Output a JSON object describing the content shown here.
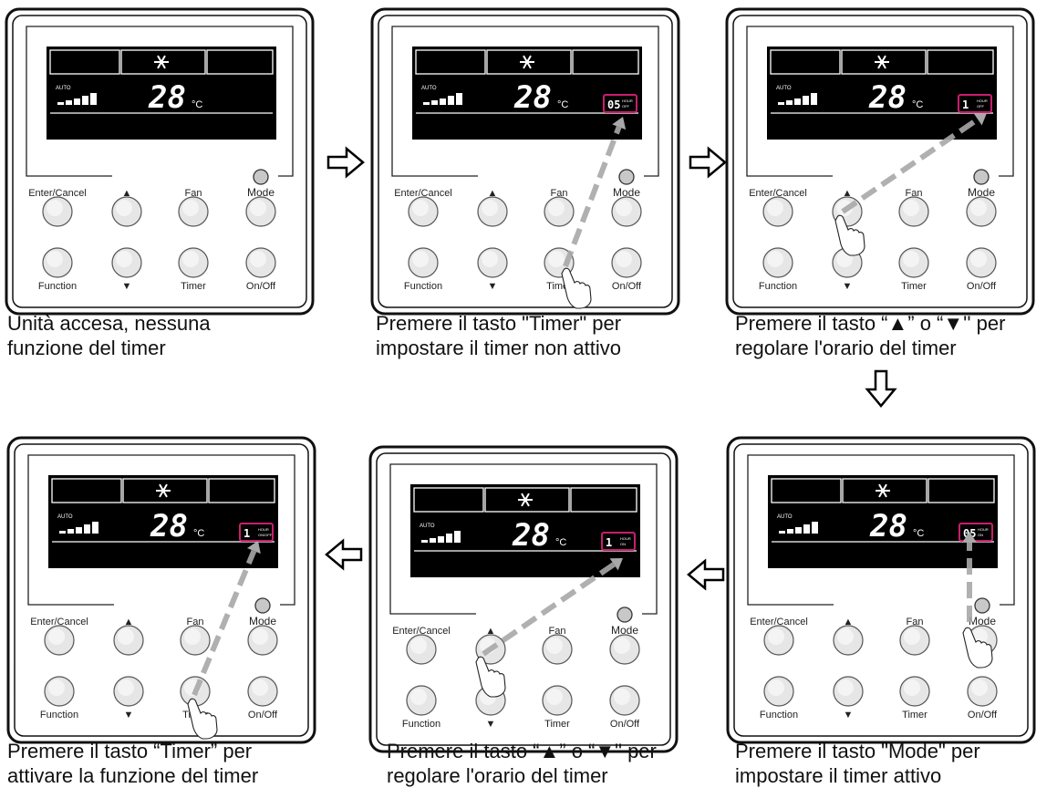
{
  "panels": [
    {
      "temp": "28",
      "unit": "°C",
      "auto": "AUTO",
      "timer": "",
      "hour": "",
      "status": "",
      "caption": [
        "Unità accesa, nessuna",
        "funzione del timer"
      ]
    },
    {
      "temp": "28",
      "unit": "°C",
      "auto": "AUTO",
      "timer": "05",
      "hour": "HOUR",
      "status": "OFF",
      "caption": [
        "Premere il tasto \"Timer\" per",
        "impostare il timer non attivo"
      ]
    },
    {
      "temp": "28",
      "unit": "°C",
      "auto": "AUTO",
      "timer": "1",
      "hour": "HOUR",
      "status": "OFF",
      "caption": [
        "Premere il tasto “▲” o “▼'' per",
        "regolare l'orario del timer"
      ]
    },
    {
      "temp": "28",
      "unit": "°C",
      "auto": "AUTO",
      "timer": "1",
      "hour": "HOUR",
      "status": "ON/OFF",
      "caption": [
        "Premere il tasto “Timer” per",
        "attivare la funzione del timer"
      ]
    },
    {
      "temp": "28",
      "unit": "°C",
      "auto": "AUTO",
      "timer": "1",
      "hour": "HOUR",
      "status": "ON",
      "caption": [
        "Premere il tasto “▲” o “▼\" per",
        "regolare l'orario del timer"
      ]
    },
    {
      "temp": "28",
      "unit": "°C",
      "auto": "AUTO",
      "timer": "05",
      "hour": "HOUR",
      "status": "ON",
      "caption": [
        "Premere il tasto \"Mode\" per",
        "impostare il timer attivo"
      ]
    }
  ],
  "buttons": {
    "enter_cancel": "Enter/Cancel",
    "up": "▲",
    "fan": "Fan",
    "mode": "Mode",
    "function": "Function",
    "down": "▼",
    "timer": "Timer",
    "on_off": "On/Off"
  },
  "icons": {
    "mode_symbol": "snowflake-icon",
    "flow_arrow": "hollow-arrow-icon",
    "finger": "pointing-hand-icon"
  },
  "colors": {
    "highlight": "#c81e6e",
    "lcd": "#000000",
    "frame": "#111111",
    "button_fill": "#e6e6e6",
    "guide_arrow": "#a8a8a8"
  }
}
